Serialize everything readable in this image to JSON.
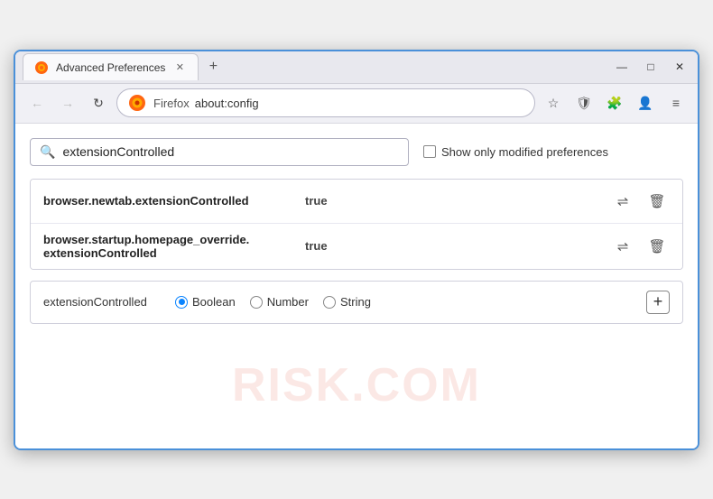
{
  "browser": {
    "title_bar": {
      "tab_label": "Advanced Preferences",
      "close_icon": "✕",
      "new_tab_icon": "+"
    },
    "window_controls": {
      "minimize_icon": "—",
      "restore_icon": "□",
      "close_icon": "✕"
    },
    "toolbar": {
      "back_icon": "←",
      "forward_icon": "→",
      "reload_icon": "↻",
      "browser_name": "Firefox",
      "address": "about:config",
      "star_icon": "☆",
      "shield_icon": "🛡",
      "menu_icon": "≡"
    }
  },
  "page": {
    "search": {
      "placeholder": "extensionControlled",
      "value": "extensionControlled"
    },
    "show_modified": {
      "label": "Show only modified preferences",
      "checked": false
    },
    "results": [
      {
        "name": "browser.newtab.extensionControlled",
        "value": "true"
      },
      {
        "name1": "browser.startup.homepage_override.",
        "name2": "extensionControlled",
        "value": "true"
      }
    ],
    "add_preference": {
      "name": "extensionControlled",
      "types": [
        {
          "label": "Boolean",
          "selected": true
        },
        {
          "label": "Number",
          "selected": false
        },
        {
          "label": "String",
          "selected": false
        }
      ],
      "add_icon": "+"
    },
    "watermark": "RISK.COM"
  }
}
